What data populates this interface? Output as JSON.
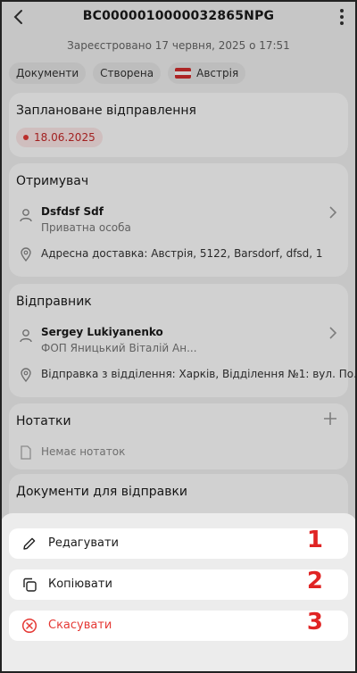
{
  "header": {
    "title": "BC0000010000032865NPG",
    "registered": "Зареєстровано 17 червня, 2025 о 17:51"
  },
  "chips": [
    "Документи",
    "Створена",
    "Австрія"
  ],
  "scheduled": {
    "title": "Заплановане відправлення",
    "date": "18.06.2025"
  },
  "recipient": {
    "title": "Отримувач",
    "name": "Dsfdsf Sdf",
    "type": "Приватна особа",
    "address": "Адресна доставка: Австрія, 5122, Barsdorf, dfsd, 1"
  },
  "sender": {
    "title": "Відправник",
    "name": "Sergey Lukiyanenko",
    "company": "ФОП Яницький Віталій Ан...",
    "address": "Відправка з відділення: Харків, Відділення №1: вул. По..."
  },
  "notes": {
    "title": "Нотатки",
    "empty": "Немає нотаток"
  },
  "documents": {
    "title": "Документи для відправки"
  },
  "sheet": {
    "actions": [
      {
        "label": "Редагувати",
        "number": "1"
      },
      {
        "label": "Копіювати",
        "number": "2"
      },
      {
        "label": "Скасувати",
        "number": "3"
      }
    ]
  },
  "colors": {
    "danger": "#e53935",
    "annotation": "#e02424"
  }
}
